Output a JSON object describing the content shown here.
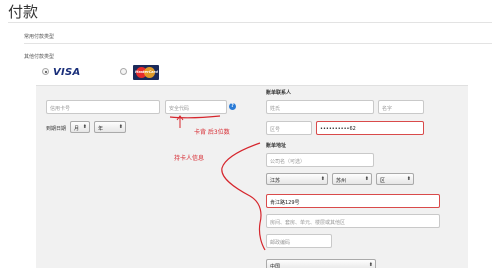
{
  "page": {
    "title": "付款"
  },
  "payment_types": {
    "saved_label": "常用付款类型",
    "other_label": "其他付款类型",
    "options": [
      {
        "name": "VISA",
        "selected": true
      },
      {
        "name": "MasterCard",
        "selected": false
      }
    ]
  },
  "card": {
    "card_number_placeholder": "信用卡号",
    "security_code_placeholder": "安全代码",
    "expiry_label": "到期日期",
    "month_value": "月",
    "year_value": "年"
  },
  "billing_contact": {
    "heading": "账单联系人",
    "last_name_placeholder": "姓氏",
    "first_name_placeholder": "名字",
    "area_code_placeholder": "区号",
    "phone_value": "••••••••••62"
  },
  "billing_address": {
    "heading": "账单地址",
    "company_placeholder": "公司名（可选）",
    "province_value": "江苏",
    "city_value": "苏州",
    "district_value": "区",
    "street_value": "肯江路129号",
    "address2_placeholder": "房间、套房、单元、楼层或其他区",
    "postal_placeholder": "邮政编码",
    "country_value": "中国"
  },
  "annotations": {
    "card_back": "卡背  后3位数",
    "cardholder": "持卡人信息"
  },
  "colors": {
    "annotation": "#d6262d",
    "visa": "#1a2f7a",
    "help": "#2a7bd6"
  }
}
